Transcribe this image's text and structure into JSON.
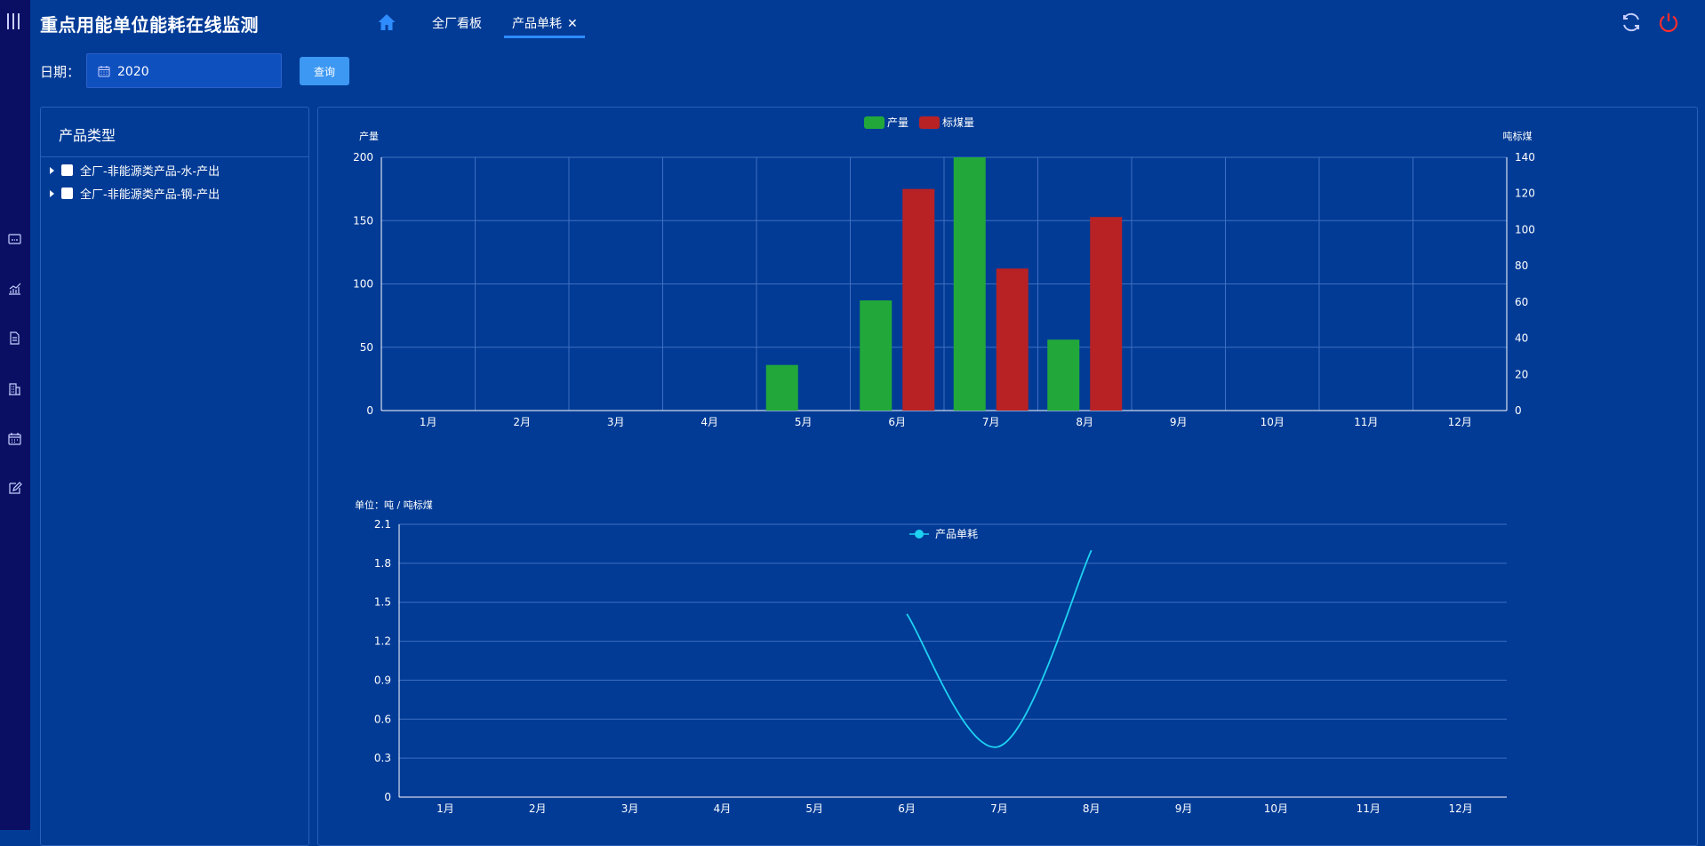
{
  "app": {
    "title": "重点用能单位能耗在线监测"
  },
  "tabs": [
    {
      "label": "全厂看板",
      "active": false
    },
    {
      "label": "产品单耗",
      "active": true,
      "closable": true
    }
  ],
  "tab_close_glyph": "✕",
  "icons": {
    "sidebar_menu": "hamburger-vertical-icon",
    "home": "home-icon",
    "refresh": "refresh-icon",
    "power": "power-icon",
    "calendar": "calendar-icon",
    "sidebar": [
      "monitor-icon",
      "bar-chart-icon",
      "document-icon",
      "building-icon",
      "calendar-icon",
      "edit-icon"
    ]
  },
  "filter": {
    "date_label": "日期：",
    "date_value": "2020",
    "query_label": "查询"
  },
  "tree": {
    "title": "产品类型",
    "items": [
      {
        "label": "全厂-非能源类产品-水-产出",
        "checked": false
      },
      {
        "label": "全厂-非能源类产品-钢-产出",
        "checked": false
      }
    ]
  },
  "colors": {
    "background": "#013b96",
    "sidebar": "#0b0f63",
    "production": "#22a83a",
    "coal": "#b82225",
    "line": "#1ed2f2",
    "query_button": "#3d98f3",
    "power_icon": "#ff2d2d"
  },
  "chart_data": [
    {
      "type": "bar",
      "legend_position": "top-center",
      "grid": true,
      "categories": [
        "1月",
        "2月",
        "3月",
        "4月",
        "5月",
        "6月",
        "7月",
        "8月",
        "9月",
        "10月",
        "11月",
        "12月"
      ],
      "series": [
        {
          "name": "产量",
          "axis": "left",
          "values": [
            null,
            null,
            null,
            null,
            36,
            87,
            200,
            56,
            null,
            null,
            null,
            null
          ]
        },
        {
          "name": "标煤量",
          "axis": "right",
          "values": [
            null,
            null,
            null,
            null,
            null,
            122.5,
            78.5,
            107,
            null,
            null,
            null,
            null
          ]
        }
      ],
      "y_left": {
        "label": "产量",
        "ylim": [
          0,
          200
        ],
        "ticks": [
          0,
          50,
          100,
          150,
          200
        ]
      },
      "y_right": {
        "label": "吨标煤",
        "ylim": [
          0,
          140
        ],
        "ticks": [
          0,
          20,
          40,
          60,
          80,
          100,
          120,
          140
        ]
      }
    },
    {
      "type": "line",
      "legend_position": "top-center",
      "grid": true,
      "smooth": true,
      "unit_label": "单位：吨 / 吨标煤",
      "categories": [
        "1月",
        "2月",
        "3月",
        "4月",
        "5月",
        "6月",
        "7月",
        "8月",
        "9月",
        "10月",
        "11月",
        "12月"
      ],
      "series": [
        {
          "name": "产品单耗",
          "values": [
            null,
            null,
            null,
            null,
            null,
            1.41,
            0.39,
            1.9,
            null,
            null,
            null,
            null
          ]
        }
      ],
      "ylim": [
        0,
        2.1
      ],
      "ticks": [
        "0",
        "0.3",
        "0.6",
        "0.9",
        "1.2",
        "1.5",
        "1.8",
        "2.1"
      ]
    }
  ]
}
